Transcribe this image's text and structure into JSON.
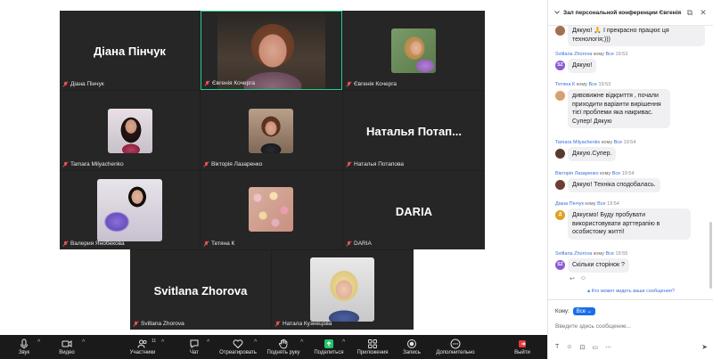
{
  "participants": [
    {
      "name": "Діана Пінчук",
      "big_name": "Діана Пінчук"
    },
    {
      "name": "Євгенія Кочерга",
      "active": true
    },
    {
      "name": "Євгенія Кочерга"
    },
    {
      "name": "Tamara Milyachenko"
    },
    {
      "name": "Вікторія Лазаренко"
    },
    {
      "name": "Наталья Потапова",
      "big_name": "Наталья Потап..."
    },
    {
      "name": "Валерия Янобекова"
    },
    {
      "name": "Тетяна К"
    },
    {
      "name": "DARIA",
      "big_name": "DARIA"
    },
    {
      "name": "Svitlana Zhorova",
      "big_name": "Svitlana Zhorova"
    },
    {
      "name": "Натала Кузнецова"
    }
  ],
  "toolbar": {
    "audio": "Звук",
    "video": "Видео",
    "participants": "Участники",
    "participants_count": "11",
    "chat": "Чат",
    "react": "Отреагировать",
    "raise_hand": "Поднять руку",
    "share": "Поделиться",
    "apps": "Приложения",
    "record": "Запись",
    "more": "Дополнительно",
    "leave": "Выйти",
    "colors": {
      "share_green": "#23c46b",
      "leave_red": "#e03a3a"
    }
  },
  "chat": {
    "title": "Зал персональной конференции Євгенія К...",
    "messages": [
      {
        "text": "Дякую! 🙏 І прекрасно працює ця технологія;)))",
        "avatar_color": "#a07050"
      },
      {
        "sender": "Svitlana Zhorova",
        "to_word": "кому",
        "recipient": "Все",
        "time": "19:53",
        "initials": "SZ",
        "avatar_color": "#8d5bd6",
        "text": "Дякую!"
      },
      {
        "sender": "Тетяна К",
        "to_word": "кому",
        "recipient": "Все",
        "time": "19:53",
        "avatar_color": "#d8a070",
        "text": "дивовижне відкриття , почали приходити варіанти вирішення тієї проблеми яка накривас. Супер! Дякую"
      },
      {
        "sender": "Tamara Milyachenko",
        "to_word": "кому",
        "recipient": "Все",
        "time": "19:54",
        "avatar_color": "#5a3a30",
        "text": "Дякую.Супер."
      },
      {
        "sender": "Вікторія Лазаренко",
        "to_word": "кому",
        "recipient": "Все",
        "time": "19:54",
        "avatar_color": "#6a4030",
        "text": "Дякую! Техніка сподобалась."
      },
      {
        "sender": "Діана Пінчук",
        "to_word": "кому",
        "recipient": "Все",
        "time": "19:54",
        "initials": "Д",
        "avatar_color": "#e0a020",
        "text": "Дякуємо! Буду пробувати використовувати арттерапію в особистому житті!"
      },
      {
        "sender": "Svitlana Zhorova",
        "to_word": "кому",
        "recipient": "Все",
        "time": "19:55",
        "initials": "SZ",
        "avatar_color": "#8d5bd6",
        "text": "Скільки сторінок ?"
      }
    ],
    "visibility_notice": "Кто может видеть ваши сообщения?",
    "to_label": "Кому:",
    "to_value": "Все",
    "input_placeholder": "Введите здесь сообщение..."
  }
}
